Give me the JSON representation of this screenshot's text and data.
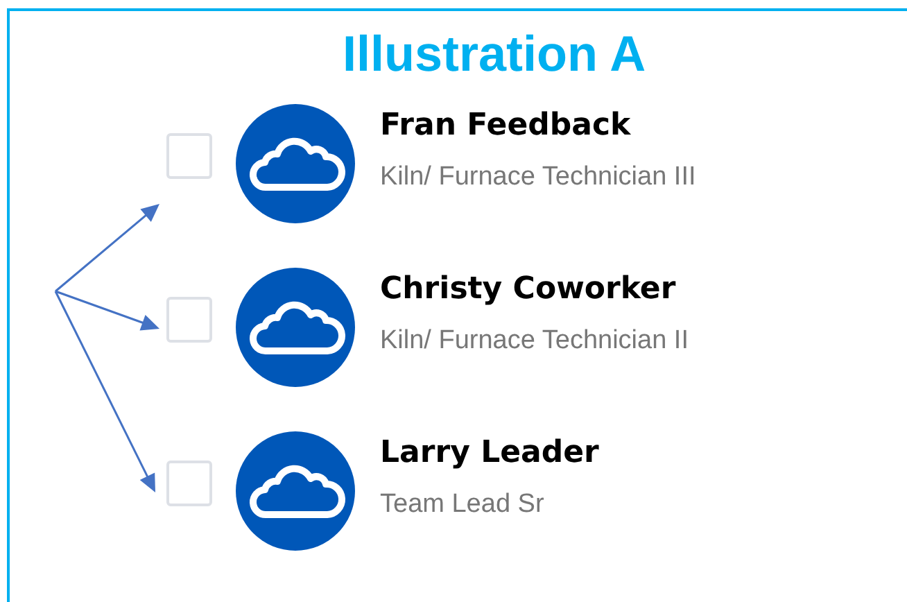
{
  "title": "Illustration A",
  "people": [
    {
      "name": "Fran Feedback",
      "role": "Kiln/ Furnace Technician III",
      "checked": false
    },
    {
      "name": "Christy Coworker",
      "role": "Kiln/ Furnace Technician II",
      "checked": false
    },
    {
      "name": "Larry Leader",
      "role": "Team Lead Sr",
      "checked": false
    }
  ]
}
